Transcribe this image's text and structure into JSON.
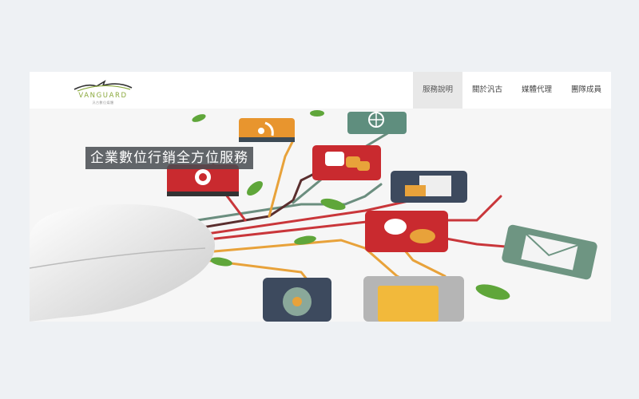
{
  "brand": {
    "name": "VANGUARD",
    "subtitle": "汎古數位媒體",
    "accent": "#8aa83c"
  },
  "nav": {
    "items": [
      {
        "label": "服務說明",
        "active": true
      },
      {
        "label": "關於汎古",
        "active": false
      },
      {
        "label": "媒體代理",
        "active": false
      },
      {
        "label": "團隊成員",
        "active": false
      }
    ]
  },
  "hero": {
    "title": "企業數位行銷全方位服務",
    "icons": [
      "rss-icon",
      "globe-icon",
      "chat-bubbles-icon",
      "at-sign-icon",
      "slideshow-icon",
      "speech-bubbles-icon",
      "mail-icon",
      "cd-disc-icon",
      "folder-icon",
      "computer-mouse-icon"
    ]
  }
}
